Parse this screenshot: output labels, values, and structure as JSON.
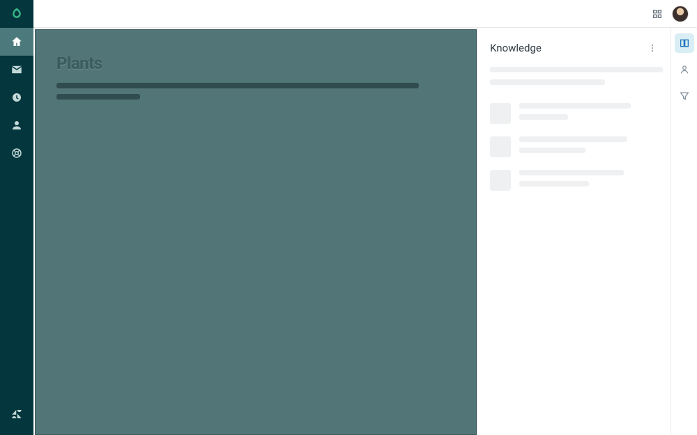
{
  "sidebar": {
    "items": [
      {
        "name": "home"
      },
      {
        "name": "mail"
      },
      {
        "name": "clock"
      },
      {
        "name": "person"
      },
      {
        "name": "lifebuoy"
      }
    ]
  },
  "workspace": {
    "title": "Plants",
    "skeleton_widths": [
      520,
      120
    ]
  },
  "knowledge": {
    "title": "Knowledge",
    "top_line_widths": [
      248,
      165
    ],
    "items": [
      {
        "l1": 160,
        "l2": 70
      },
      {
        "l1": 155,
        "l2": 95
      },
      {
        "l1": 150,
        "l2": 100
      }
    ]
  },
  "right_rail": {
    "items": [
      {
        "name": "book",
        "active": true
      },
      {
        "name": "user",
        "active": false
      },
      {
        "name": "filter",
        "active": false
      }
    ]
  }
}
